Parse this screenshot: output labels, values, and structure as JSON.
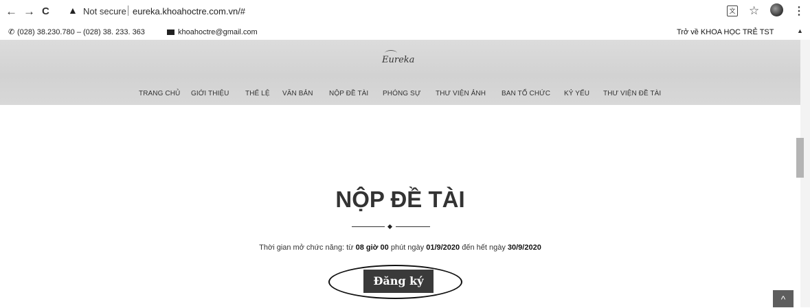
{
  "browser": {
    "back": "←",
    "forward": "→",
    "reload": "C",
    "warning_icon": "▲",
    "security_label": "Not secure",
    "url": "eureka.khoahoctre.com.vn/#",
    "translate_icon": "文",
    "star_icon": "☆",
    "menu_icon": "⋮"
  },
  "contact_bar": {
    "phone_icon": "✆",
    "phone": "(028) 38.230.780 – (028) 38. 233. 363",
    "email": "khoahoctre@gmail.com",
    "back_link": "Trở về KHOA HỌC TRẺ TST",
    "scroll_up": "▲"
  },
  "header": {
    "logo_text": "Eureka",
    "menu": [
      {
        "label": "TRANG CHỦ"
      },
      {
        "label": "GIỚI THIỆU"
      },
      {
        "label": "THỂ LỆ"
      },
      {
        "label": "VĂN BẢN"
      },
      {
        "label": "NỘP ĐỀ TÀI"
      },
      {
        "label": "PHÓNG SỰ"
      },
      {
        "label": "THƯ VIỆN ẢNH"
      },
      {
        "label": "BAN TỔ CHỨC"
      },
      {
        "label": "KỶ YẾU"
      },
      {
        "label": "THƯ VIỆN ĐỀ TÀI"
      }
    ]
  },
  "main": {
    "title": "NỘP ĐỀ TÀI",
    "info_prefix": "Thời gian mở chức năng: từ ",
    "info_time": "08 giờ 00",
    "info_mid": " phút ngày ",
    "info_start": "01/9/2020",
    "info_mid2": " đến hết ngày ",
    "info_end": "30/9/2020",
    "register_button": "Đăng ký",
    "back_to_top": "^"
  }
}
